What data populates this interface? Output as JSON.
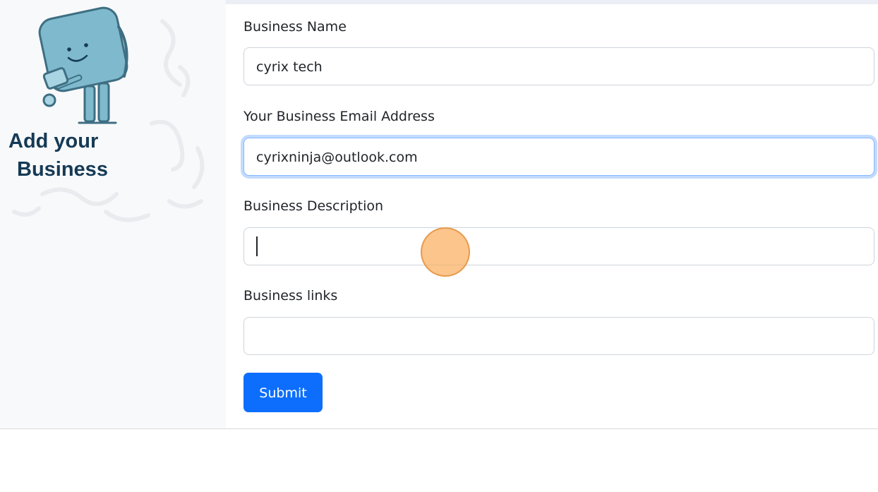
{
  "brand": {
    "title_line1": "Add your",
    "title_line2": "Business"
  },
  "form": {
    "business_name": {
      "label": "Business Name",
      "value": "cyrix tech"
    },
    "email": {
      "label": "Your Business Email Address",
      "value": "cyrixninja@outlook.com"
    },
    "description": {
      "label": "Business Description",
      "value": ""
    },
    "links": {
      "label": "Business links",
      "value": ""
    },
    "submit_label": "Submit"
  },
  "colors": {
    "primary": "#0d6efd",
    "focus_ring": "#86b7fe",
    "brand_text": "#163a55",
    "mascot": "#7fb9cd",
    "click_marker": "#faaf5f"
  },
  "icons": {
    "mascot": "smiling-box-mascot-illustration",
    "click_marker": "click-indicator"
  }
}
